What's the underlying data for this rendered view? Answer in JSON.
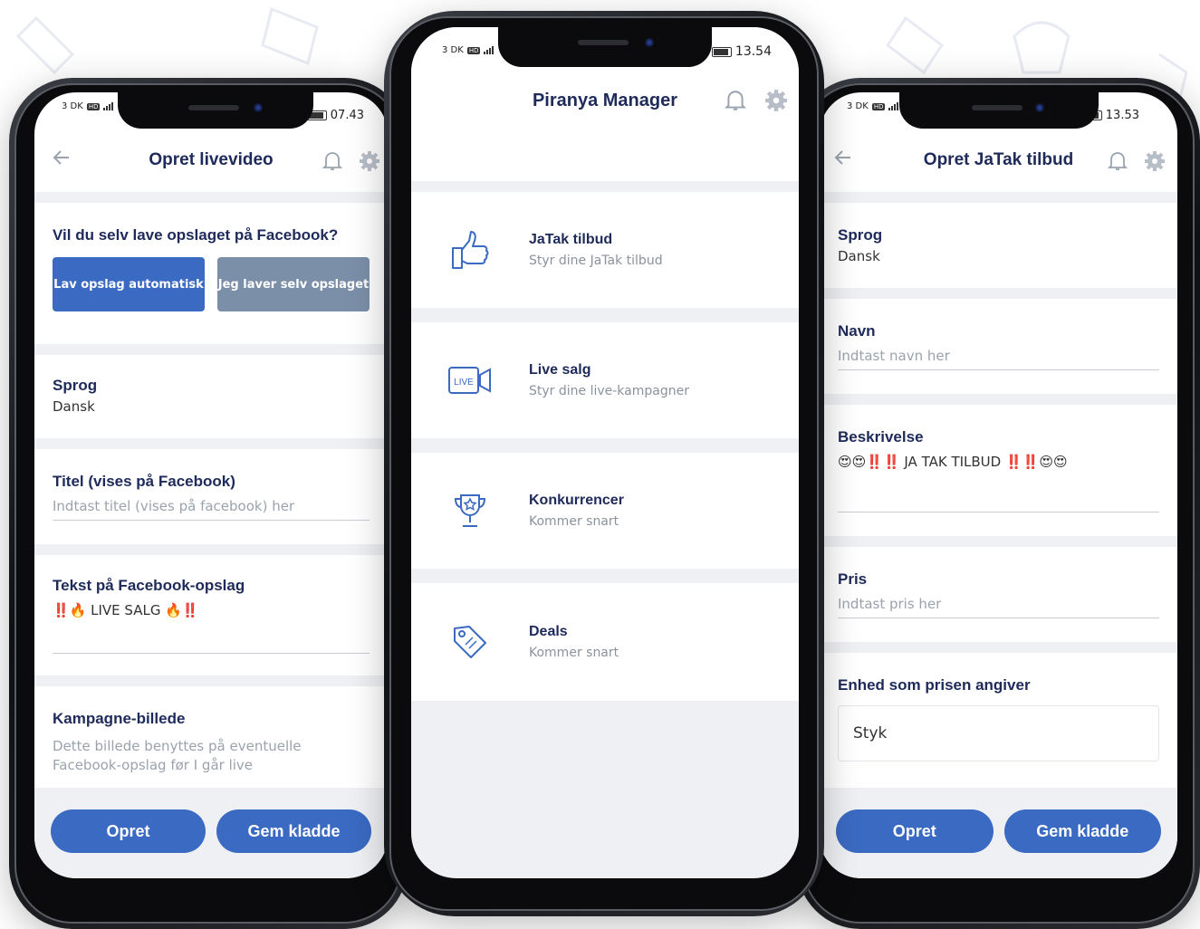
{
  "colors": {
    "accent": "#3b6ac2",
    "navy": "#1e2a5a",
    "muted": "#8a929c",
    "grey_button": "#7b8fa8"
  },
  "left_phone": {
    "status": {
      "carrier": "3 DK",
      "hd": "HD",
      "time": "07.43"
    },
    "title": "Opret livevideo",
    "question": "Vil du selv lave opslaget på Facebook?",
    "btn_auto": "Lav opslag automatisk",
    "btn_self": "Jeg laver selv opslaget",
    "sprog_label": "Sprog",
    "sprog_value": "Dansk",
    "titel_label": "Titel (vises på Facebook)",
    "titel_placeholder": "Indtast titel (vises på facebook) her",
    "tekst_label": "Tekst på Facebook-opslag",
    "tekst_value": "‼️🔥 LIVE SALG 🔥‼️",
    "kampagne_label": "Kampagne-billede",
    "kampagne_desc": "Dette billede benyttes på eventuelle Facebook-opslag før I går live",
    "btn_create": "Opret",
    "btn_draft": "Gem kladde"
  },
  "center_phone": {
    "status": {
      "carrier": "3 DK",
      "hd": "HD",
      "time": "13.54"
    },
    "title": "Piranya Manager",
    "items": [
      {
        "title": "JaTak tilbud",
        "subtitle": "Styr dine JaTak tilbud",
        "icon": "thumbs-up-icon"
      },
      {
        "title": "Live salg",
        "subtitle": "Styr dine live-kampagner",
        "icon": "live-video-icon"
      },
      {
        "title": "Konkurrencer",
        "subtitle": "Kommer snart",
        "icon": "trophy-icon"
      },
      {
        "title": "Deals",
        "subtitle": "Kommer snart",
        "icon": "price-tag-icon"
      }
    ],
    "live_badge": "LIVE"
  },
  "right_phone": {
    "status": {
      "carrier": "3 DK",
      "hd": "HD",
      "time": "13.53"
    },
    "title": "Opret JaTak tilbud",
    "sprog_label": "Sprog",
    "sprog_value": "Dansk",
    "navn_label": "Navn",
    "navn_placeholder": "Indtast navn her",
    "beskrivelse_label": "Beskrivelse",
    "beskrivelse_value": "😍😍‼️‼️ JA TAK TILBUD ‼️‼️😍😍",
    "pris_label": "Pris",
    "pris_placeholder": "Indtast pris her",
    "enhed_label": "Enhed som prisen angiver",
    "enhed_value": "Styk",
    "btn_create": "Opret",
    "btn_draft": "Gem kladde"
  }
}
